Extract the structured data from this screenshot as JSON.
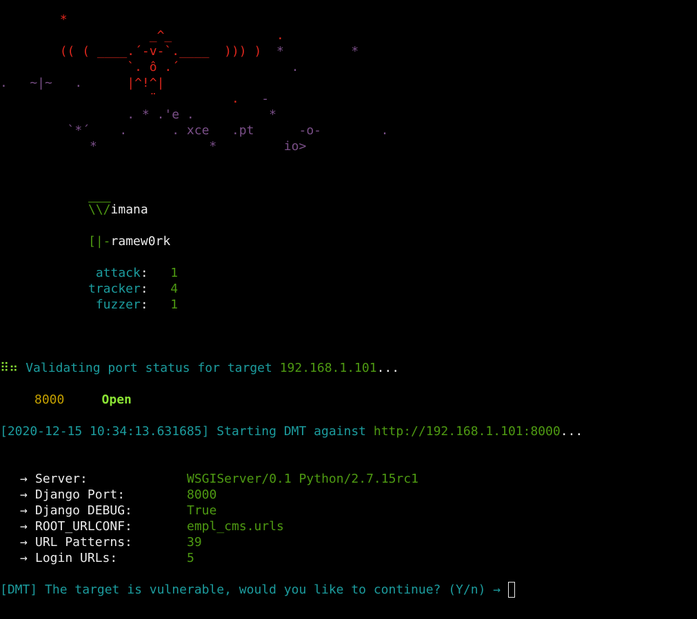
{
  "banner": {
    "art_lines": [
      {
        "parts": [
          {
            "text": "        *",
            "color": "red"
          }
        ]
      },
      {
        "parts": [
          {
            "text": "                    _^_",
            "color": "red"
          },
          {
            "text": "              .",
            "color": "red"
          }
        ]
      },
      {
        "parts": [
          {
            "text": "        (( ( ____.´-v-`.____  ))) )",
            "color": "red"
          },
          {
            "text": "  *         *",
            "color": "purple"
          }
        ]
      },
      {
        "parts": [
          {
            "text": "                 `. ô .´",
            "color": "red"
          },
          {
            "text": "               .",
            "color": "purple"
          }
        ]
      },
      {
        "parts": [
          {
            "text": ".   ~|~   .",
            "color": "purple"
          },
          {
            "text": "      |^!^|",
            "color": "red"
          }
        ]
      },
      {
        "parts": [
          {
            "text": "                    ¨",
            "color": "red"
          },
          {
            "text": "          .",
            "color": "red"
          },
          {
            "text": "   -",
            "color": "purple"
          }
        ]
      },
      {
        "parts": [
          {
            "text": "                 . * .'e .          *",
            "color": "purple"
          }
        ]
      },
      {
        "parts": [
          {
            "text": "         `*´    .      . xce   .pt      -o-        .",
            "color": "purple"
          }
        ]
      },
      {
        "parts": [
          {
            "text": "            *               *         io>",
            "color": "purple"
          }
        ]
      }
    ]
  },
  "logo": {
    "line1_prefix": "\\\\/",
    "line1_text": "imana",
    "line2_prefix": "[|-",
    "line2_text": "ramew0rk"
  },
  "stats": [
    {
      "label": " attack",
      "sep": ":",
      "value": "1"
    },
    {
      "label": "tracker",
      "sep": ":",
      "value": "4"
    },
    {
      "label": " fuzzer",
      "sep": ":",
      "value": "1"
    }
  ],
  "validate": {
    "spinner": "⠿⠶",
    "text": "Validating port status for target",
    "target": "192.168.1.101",
    "ellipsis": "..."
  },
  "port": {
    "number": "8000",
    "status": "Open"
  },
  "start": {
    "timestamp": "[2020-12-15 10:34:13.631685]",
    "text": "Starting DMT against",
    "url": "http://192.168.1.101:8000",
    "ellipsis": "..."
  },
  "info": [
    {
      "arrow": "→",
      "label": "Server:",
      "value": "WSGIServer/0.1 Python/2.7.15rc1"
    },
    {
      "arrow": "→",
      "label": "Django Port:",
      "value": "8000"
    },
    {
      "arrow": "→",
      "label": "Django DEBUG:",
      "value": "True"
    },
    {
      "arrow": "→",
      "label": "ROOT_URLCONF:",
      "value": "empl_cms.urls"
    },
    {
      "arrow": "→",
      "label": "URL Patterns:",
      "value": "39"
    },
    {
      "arrow": "→",
      "label": "Login URLs:",
      "value": "5"
    }
  ],
  "prompt": {
    "text": "[DMT] The target is vulnerable, would you like to continue? (Y/n)",
    "arrow": "→"
  },
  "colors": {
    "background": "#000000",
    "red": "#e0271d",
    "purple": "#7a4f88",
    "teal": "#1c9c9e",
    "green": "#4e9a12",
    "bright_green": "#8ae234",
    "orange": "#c4a000",
    "white": "#ececec"
  }
}
